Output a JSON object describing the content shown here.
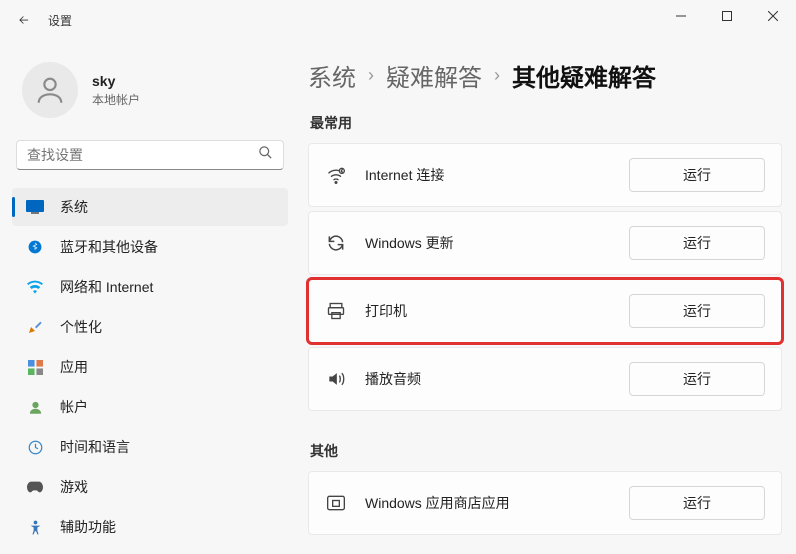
{
  "window": {
    "title": "设置"
  },
  "user": {
    "name": "sky",
    "subtitle": "本地帐户"
  },
  "search": {
    "placeholder": "查找设置"
  },
  "nav": {
    "items": [
      {
        "label": "系统"
      },
      {
        "label": "蓝牙和其他设备"
      },
      {
        "label": "网络和 Internet"
      },
      {
        "label": "个性化"
      },
      {
        "label": "应用"
      },
      {
        "label": "帐户"
      },
      {
        "label": "时间和语言"
      },
      {
        "label": "游戏"
      },
      {
        "label": "辅助功能"
      }
    ]
  },
  "breadcrumb": {
    "root": "系统",
    "mid": "疑难解答",
    "current": "其他疑难解答"
  },
  "sections": {
    "frequent_label": "最常用",
    "other_label": "其他"
  },
  "troubleshooters": {
    "internet": {
      "label": "Internet 连接",
      "run": "运行"
    },
    "update": {
      "label": "Windows 更新",
      "run": "运行"
    },
    "printer": {
      "label": "打印机",
      "run": "运行"
    },
    "audio": {
      "label": "播放音频",
      "run": "运行"
    },
    "store": {
      "label": "Windows 应用商店应用",
      "run": "运行"
    }
  }
}
